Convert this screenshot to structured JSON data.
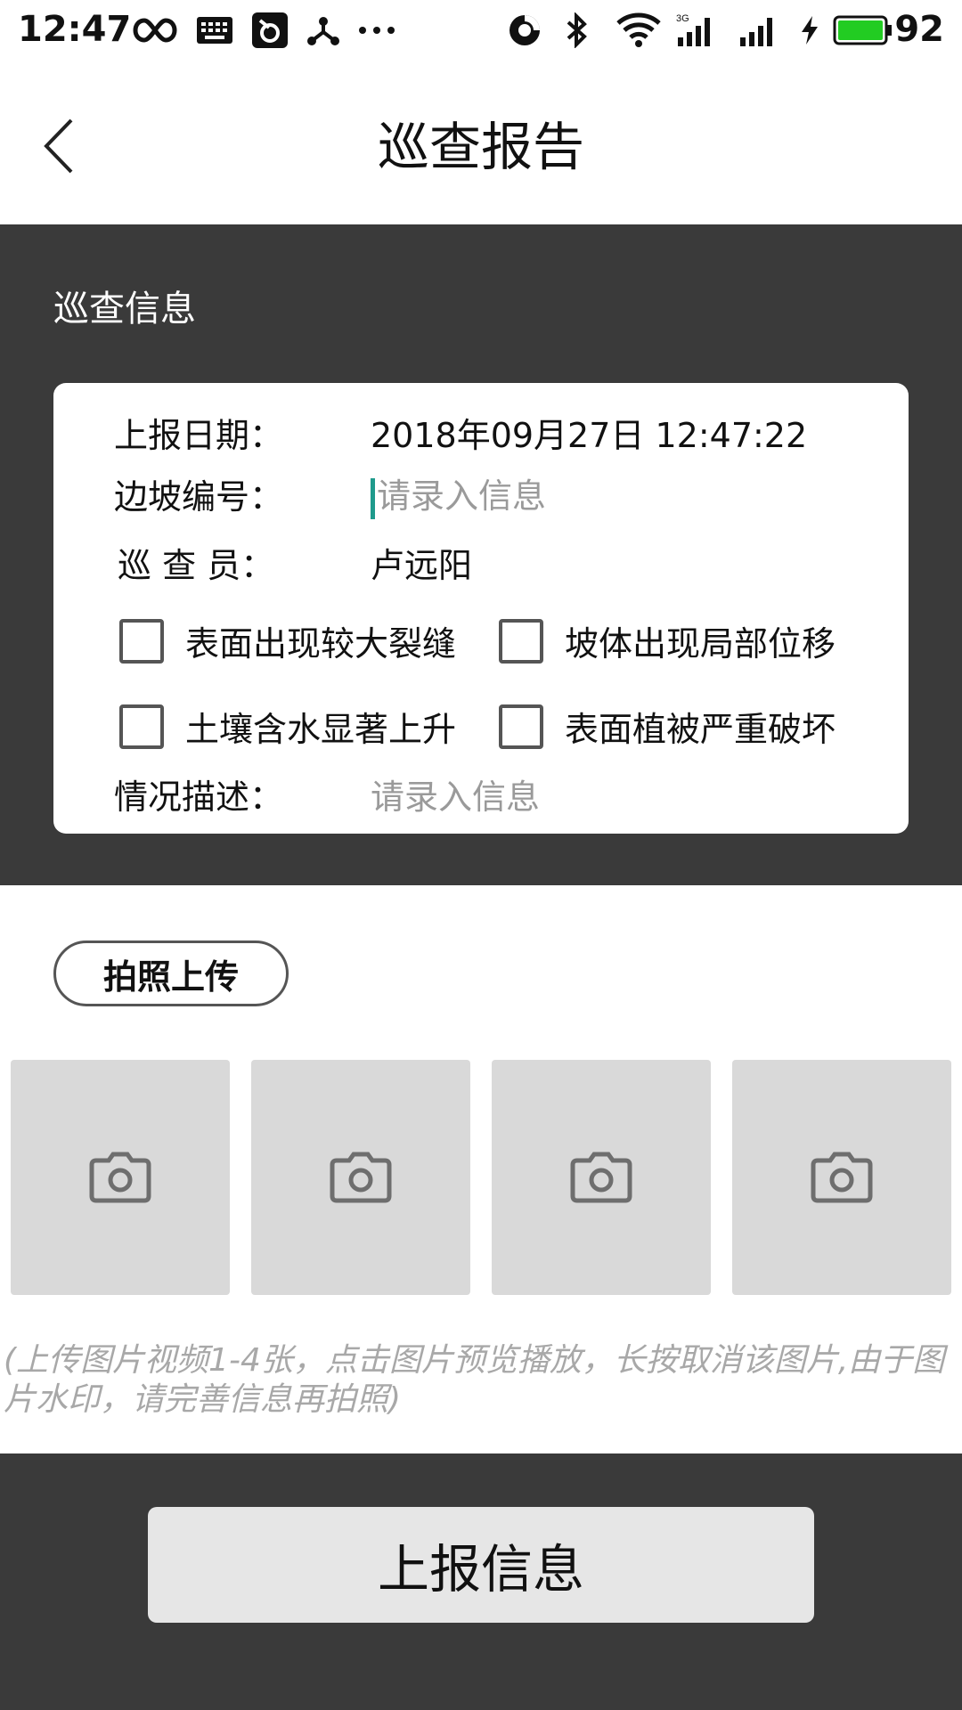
{
  "status_bar": {
    "time": "12:47",
    "battery_level": "92",
    "icons": [
      "infinity-icon",
      "keyboard-icon",
      "app-icon",
      "share-icon",
      "more-icon",
      "sync-icon",
      "bluetooth-icon",
      "wifi-icon",
      "signal-3g-icon",
      "signal-icon",
      "charging-icon",
      "battery-icon"
    ],
    "battery_color": "#22cc22"
  },
  "header": {
    "title": "巡查报告",
    "back_icon": "chevron-left-icon"
  },
  "info": {
    "section_title": "巡查信息",
    "report_date_label": "上报日期：",
    "report_date_value": "2018年09月27日 12:47:22",
    "slope_number_label": "边坡编号：",
    "slope_number_placeholder": "请录入信息",
    "inspector_label": "巡 查 员：",
    "inspector_value": "卢远阳",
    "checks": [
      {
        "label": "表面出现较大裂缝",
        "checked": false
      },
      {
        "label": "坡体出现局部位移",
        "checked": false
      },
      {
        "label": "土壤含水显著上升",
        "checked": false
      },
      {
        "label": "表面植被严重破坏",
        "checked": false
      }
    ],
    "description_label": "情况描述：",
    "description_placeholder": "请录入信息"
  },
  "photos": {
    "upload_label": "拍照上传",
    "slot_icon": "camera-icon",
    "slots": 4,
    "hint": "(上传图片视频1-4张，点击图片预览播放，长按取消该图片,由于图片水印，请完善信息再拍照)"
  },
  "footer": {
    "submit_label": "上报信息"
  },
  "colors": {
    "dark_bg": "#3a3a3a",
    "cursor": "#1f9a8c",
    "photo_slot": "#d9d9d9",
    "submit_bg": "#e6e6e6"
  }
}
